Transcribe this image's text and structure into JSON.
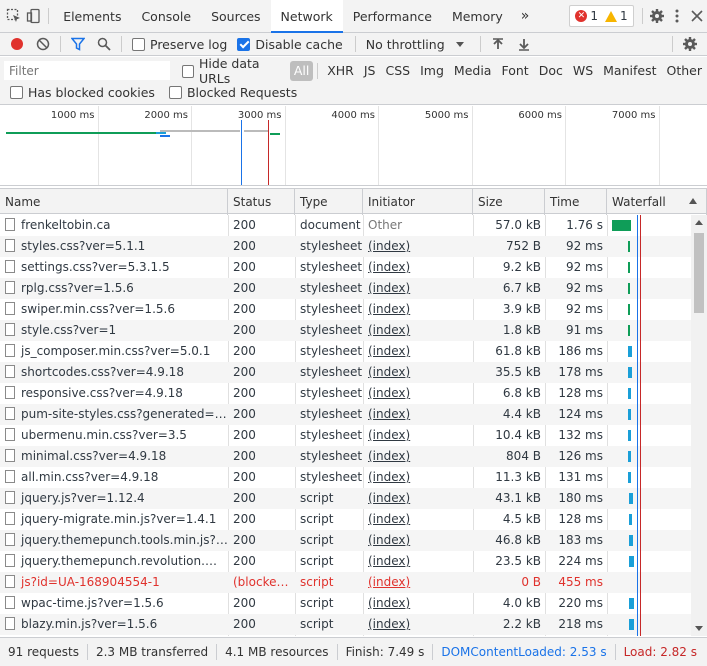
{
  "tabs": {
    "items": [
      "Elements",
      "Console",
      "Sources",
      "Network",
      "Performance",
      "Memory"
    ],
    "more": "»",
    "errors": "1",
    "warnings": "1"
  },
  "toolbar": {
    "preserve_log": "Preserve log",
    "disable_cache": "Disable cache",
    "throttling": "No throttling"
  },
  "filter": {
    "placeholder": "Filter",
    "hide_data_urls": "Hide data URLs",
    "types": [
      "All",
      "XHR",
      "JS",
      "CSS",
      "Img",
      "Media",
      "Font",
      "Doc",
      "WS",
      "Manifest",
      "Other"
    ],
    "has_blocked_cookies": "Has blocked cookies",
    "blocked_requests": "Blocked Requests"
  },
  "overview": {
    "ticks": [
      "1000 ms",
      "2000 ms",
      "3000 ms",
      "4000 ms",
      "5000 ms",
      "6000 ms",
      "7000 ms"
    ],
    "domcontentloaded_ms": 2530,
    "load_ms": 2820
  },
  "table": {
    "columns": [
      "Name",
      "Status",
      "Type",
      "Initiator",
      "Size",
      "Time",
      "Waterfall"
    ],
    "rows": [
      {
        "name": "frenkeltobin.ca",
        "status": "200",
        "type": "document",
        "initiator": "Other",
        "size": "57.0 kB",
        "time": "1.76 s",
        "blocked": false
      },
      {
        "name": "styles.css?ver=5.1.1",
        "status": "200",
        "type": "stylesheet",
        "initiator": "(index)",
        "size": "752 B",
        "time": "92 ms",
        "blocked": false
      },
      {
        "name": "settings.css?ver=5.3.1.5",
        "status": "200",
        "type": "stylesheet",
        "initiator": "(index)",
        "size": "9.2 kB",
        "time": "92 ms",
        "blocked": false
      },
      {
        "name": "rplg.css?ver=1.5.6",
        "status": "200",
        "type": "stylesheet",
        "initiator": "(index)",
        "size": "6.7 kB",
        "time": "92 ms",
        "blocked": false
      },
      {
        "name": "swiper.min.css?ver=1.5.6",
        "status": "200",
        "type": "stylesheet",
        "initiator": "(index)",
        "size": "3.9 kB",
        "time": "92 ms",
        "blocked": false
      },
      {
        "name": "style.css?ver=1",
        "status": "200",
        "type": "stylesheet",
        "initiator": "(index)",
        "size": "1.8 kB",
        "time": "91 ms",
        "blocked": false
      },
      {
        "name": "js_composer.min.css?ver=5.0.1",
        "status": "200",
        "type": "stylesheet",
        "initiator": "(index)",
        "size": "61.8 kB",
        "time": "186 ms",
        "blocked": false
      },
      {
        "name": "shortcodes.css?ver=4.9.18",
        "status": "200",
        "type": "stylesheet",
        "initiator": "(index)",
        "size": "35.5 kB",
        "time": "178 ms",
        "blocked": false
      },
      {
        "name": "responsive.css?ver=4.9.18",
        "status": "200",
        "type": "stylesheet",
        "initiator": "(index)",
        "size": "6.8 kB",
        "time": "128 ms",
        "blocked": false
      },
      {
        "name": "pum-site-styles.css?generated=160...",
        "status": "200",
        "type": "stylesheet",
        "initiator": "(index)",
        "size": "4.4 kB",
        "time": "124 ms",
        "blocked": false
      },
      {
        "name": "ubermenu.min.css?ver=3.5",
        "status": "200",
        "type": "stylesheet",
        "initiator": "(index)",
        "size": "10.4 kB",
        "time": "132 ms",
        "blocked": false
      },
      {
        "name": "minimal.css?ver=4.9.18",
        "status": "200",
        "type": "stylesheet",
        "initiator": "(index)",
        "size": "804 B",
        "time": "126 ms",
        "blocked": false
      },
      {
        "name": "all.min.css?ver=4.9.18",
        "status": "200",
        "type": "stylesheet",
        "initiator": "(index)",
        "size": "11.3 kB",
        "time": "131 ms",
        "blocked": false
      },
      {
        "name": "jquery.js?ver=1.12.4",
        "status": "200",
        "type": "script",
        "initiator": "(index)",
        "size": "43.1 kB",
        "time": "180 ms",
        "blocked": false
      },
      {
        "name": "jquery-migrate.min.js?ver=1.4.1",
        "status": "200",
        "type": "script",
        "initiator": "(index)",
        "size": "4.5 kB",
        "time": "128 ms",
        "blocked": false
      },
      {
        "name": "jquery.themepunch.tools.min.js?ver...",
        "status": "200",
        "type": "script",
        "initiator": "(index)",
        "size": "46.8 kB",
        "time": "183 ms",
        "blocked": false
      },
      {
        "name": "jquery.themepunch.revolution.min.j...",
        "status": "200",
        "type": "script",
        "initiator": "(index)",
        "size": "23.5 kB",
        "time": "224 ms",
        "blocked": false
      },
      {
        "name": "js?id=UA-168904554-1",
        "status": "(blocked:...",
        "type": "script",
        "initiator": "(index)",
        "size": "0 B",
        "time": "455 ms",
        "blocked": true
      },
      {
        "name": "wpac-time.js?ver=1.5.6",
        "status": "200",
        "type": "script",
        "initiator": "(index)",
        "size": "4.0 kB",
        "time": "220 ms",
        "blocked": false
      },
      {
        "name": "blazy.min.js?ver=1.5.6",
        "status": "200",
        "type": "script",
        "initiator": "(index)",
        "size": "2.2 kB",
        "time": "218 ms",
        "blocked": false
      }
    ]
  },
  "status": {
    "requests": "91 requests",
    "transferred": "2.3 MB transferred",
    "resources": "4.1 MB resources",
    "finish": "Finish: 7.49 s",
    "domcontentloaded": "DOMContentLoaded: 2.53 s",
    "load": "Load: 2.82 s"
  },
  "colors": {
    "accent": "#1a73e8",
    "error": "#e0322d",
    "warning": "#f7b500",
    "dcl": "#1a73e8",
    "load": "#c62828"
  }
}
